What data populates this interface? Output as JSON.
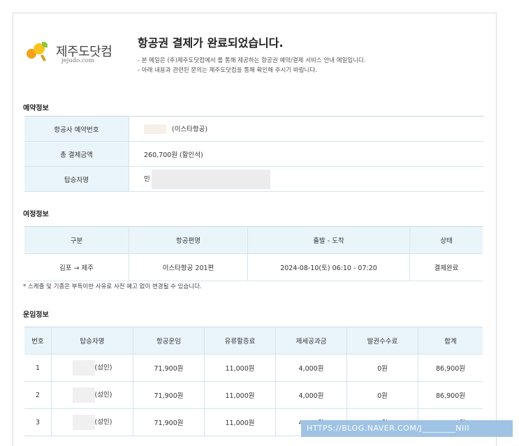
{
  "logo": {
    "name": "제주도닷컴",
    "domain": "jejudo.com"
  },
  "header": {
    "title": "항공권 결제가 완료되었습니다.",
    "notes": [
      "- 본 메일은 (주)제주도닷컴에서 를 통해 제공하는 항공권 예약/결제 서비스 안내 메일입니다.",
      "- 아래 내용과 관련된 문의는 제주도닷컴을 통해 확인해 주시기 바랍니다."
    ]
  },
  "reservation": {
    "title": "예약정보",
    "rows": [
      {
        "label": "항공사 예약번호",
        "value": "(이스타항공)"
      },
      {
        "label": "총 결제금액",
        "value": "260,700원 (할인석)"
      },
      {
        "label": "탑승자명",
        "value": "민"
      }
    ]
  },
  "itinerary": {
    "title": "여정정보",
    "headers": [
      "구분",
      "항공편명",
      "출발 - 도착",
      "상태"
    ],
    "rows": [
      [
        "김포 → 제주",
        "이스타항공 201편",
        "2024-08-10(토) 06:10 - 07:20",
        "결제완료"
      ]
    ],
    "footnote": "* 스케줄 및 기종은 부득이한 사유로 사전 예고 없이 변경될 수 있습니다."
  },
  "fare": {
    "title": "운임정보",
    "headers": [
      "번호",
      "탑승자명",
      "항공운임",
      "유류할증료",
      "제세공과금",
      "발권수수료",
      "합계"
    ],
    "rows": [
      [
        "1",
        "(성인)",
        "71,900원",
        "11,000원",
        "4,000원",
        "0원",
        "86,900원"
      ],
      [
        "2",
        "(성인)",
        "71,900원",
        "11,000원",
        "4,000원",
        "0원",
        "86,900원"
      ],
      [
        "3",
        "(성인)",
        "71,900원",
        "11,000원",
        "4,000원",
        "0원",
        "86,900원"
      ]
    ]
  },
  "watermark": "HTTPS://BLOG.NAVER.COM/J________NIII",
  "colors": {
    "header_bg": "#eaf4fb",
    "border": "#d6e3ec",
    "watermark_bg": "#9fc3e4"
  }
}
